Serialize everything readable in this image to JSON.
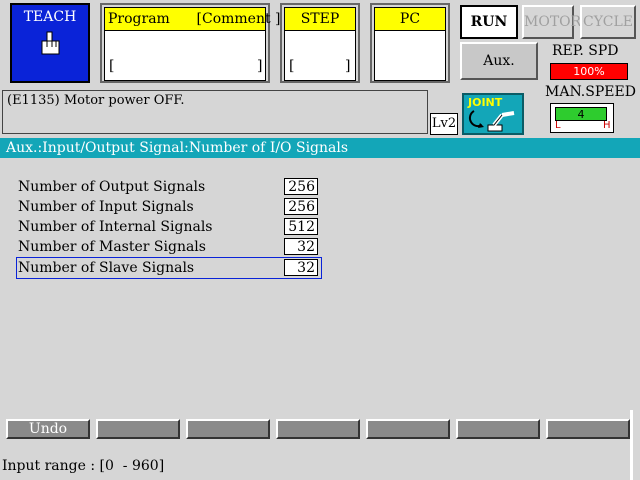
{
  "teach": {
    "label": "TEACH"
  },
  "program_box": {
    "header": "Program      [Comment ]",
    "left": "[",
    "right": "]"
  },
  "step_box": {
    "header": "STEP",
    "left": "[",
    "right": "]"
  },
  "pc_box": {
    "header": "PC"
  },
  "buttons": {
    "run": "RUN",
    "motor": "MOTOR",
    "cycle": "CYCLE",
    "aux": "Aux."
  },
  "rep_spd": {
    "label": "REP. SPD",
    "value": "100%",
    "level": 1.0
  },
  "man_speed": {
    "label": "MAN.SPEED",
    "value": "4",
    "low": "L",
    "high": "H"
  },
  "message": "(E1135) Motor power OFF.",
  "level_badge": "Lv2",
  "joint": {
    "label": "JOINT",
    "icon": "robot-arm-icon"
  },
  "screen_title": "Aux.:Input/Output Signal:Number of I/O Signals",
  "rows": [
    {
      "label": "Number of Output Signals",
      "value": "256"
    },
    {
      "label": "Number of Input Signals",
      "value": "256"
    },
    {
      "label": "Number of Internal Signals",
      "value": "512"
    },
    {
      "label": "Number of Master Signals",
      "value": "32"
    },
    {
      "label": "Number of Slave Signals",
      "value": "32"
    }
  ],
  "fkeys": [
    "Undo",
    "",
    "",
    "",
    "",
    "",
    ""
  ],
  "status": "Input range : [0  - 960]",
  "colors": {
    "accent": "#13a6b8",
    "teach": "#0a23d8",
    "header_yellow": "#ffff00",
    "rep_bar": "#ff0000",
    "man_bar": "#2ecc2e"
  }
}
